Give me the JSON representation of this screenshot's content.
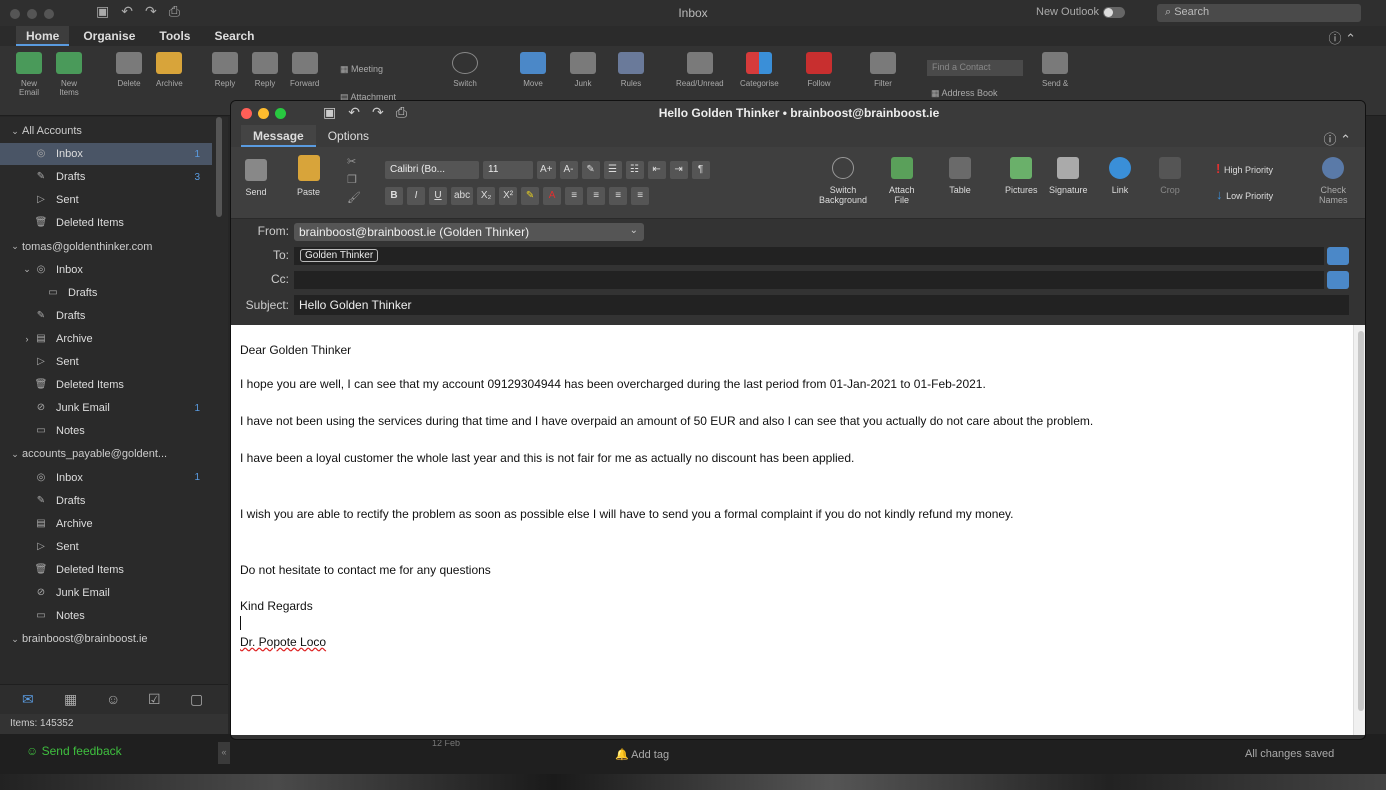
{
  "window": {
    "title": "Inbox",
    "new_outlook": "New Outlook",
    "search_placeholder": "Search"
  },
  "ribbon": {
    "tabs": [
      "Home",
      "Organise",
      "Tools",
      "Search"
    ],
    "buttons": {
      "new_email": "New\nEmail",
      "new_items": "New\nItems",
      "delete": "Delete",
      "archive": "Archive",
      "reply": "Reply",
      "reply_all": "Reply",
      "forward": "Forward",
      "meeting": "Meeting",
      "attachment": "Attachment",
      "switch": "Switch",
      "move": "Move",
      "junk": "Junk",
      "rules": "Rules",
      "read_unread": "Read/Unread",
      "categorise": "Categorise",
      "follow": "Follow",
      "filter": "Filter",
      "find_contact": "Find a Contact",
      "address_book": "Address Book",
      "send_receive": "Send &"
    }
  },
  "sidebar": {
    "items": [
      {
        "label": "All Accounts",
        "type": "account"
      },
      {
        "label": "Inbox",
        "count": "1",
        "icon": "inbox-icon",
        "selected": true
      },
      {
        "label": "Drafts",
        "count": "3",
        "icon": "drafts-icon"
      },
      {
        "label": "Sent",
        "icon": "sent-icon"
      },
      {
        "label": "Deleted Items",
        "icon": "trash-icon"
      },
      {
        "label": "tomas@goldenthinker.com",
        "type": "account"
      },
      {
        "label": "Inbox",
        "icon": "inbox-icon"
      },
      {
        "label": "Drafts",
        "icon": "folder-icon"
      },
      {
        "label": "Drafts",
        "icon": "drafts-icon"
      },
      {
        "label": "Archive",
        "icon": "archive-icon"
      },
      {
        "label": "Sent",
        "icon": "sent-icon"
      },
      {
        "label": "Deleted Items",
        "icon": "trash-icon"
      },
      {
        "label": "Junk Email",
        "count": "1",
        "icon": "junk-icon"
      },
      {
        "label": "Notes",
        "icon": "notes-icon"
      },
      {
        "label": "accounts_payable@goldent...",
        "type": "account"
      },
      {
        "label": "Inbox",
        "count": "1",
        "icon": "inbox-icon"
      },
      {
        "label": "Drafts",
        "icon": "drafts-icon"
      },
      {
        "label": "Archive",
        "icon": "archive-icon"
      },
      {
        "label": "Sent",
        "icon": "sent-icon"
      },
      {
        "label": "Deleted Items",
        "icon": "trash-icon"
      },
      {
        "label": "Junk Email",
        "icon": "junk-icon"
      },
      {
        "label": "Notes",
        "icon": "notes-icon"
      },
      {
        "label": "brainboost@brainboost.ie",
        "type": "account"
      }
    ],
    "items_count": "Items: 145352"
  },
  "status": {
    "feedback": "Send feedback",
    "date": "12 Feb",
    "add_tag": "Add tag",
    "saved": "All changes saved"
  },
  "compose": {
    "title": "Hello Golden Thinker • brainboost@brainboost.ie",
    "tabs": [
      "Message",
      "Options"
    ],
    "buttons": {
      "send": "Send",
      "paste": "Paste",
      "font": "Calibri (Bo...",
      "size": "11",
      "switch_background": "Switch\nBackground",
      "attach_file": "Attach\nFile",
      "table": "Table",
      "pictures": "Pictures",
      "signature": "Signature",
      "link": "Link",
      "crop": "Crop",
      "high_priority": "High Priority",
      "low_priority": "Low Priority",
      "check_names": "Check\nNames"
    },
    "fields": {
      "from_label": "From:",
      "from_value": "brainboost@brainboost.ie (Golden Thinker)",
      "to_label": "To:",
      "to_value": "Golden Thinker",
      "cc_label": "Cc:",
      "subject_label": "Subject:",
      "subject_value": "Hello Golden Thinker"
    },
    "body": [
      "Dear Golden Thinker",
      "I hope you are well, I can see that my account 09129304944 has been overcharged during the last period from 01-Jan-2021  to 01-Feb-2021.",
      "I have not been using the services during that time and I have overpaid an amount of 50 EUR and also I can see that you actually do not care about the problem.",
      "I have been a loyal customer the whole last year and this is not fair for me as actually no discount has been applied.",
      "I wish you are able to rectify the problem as soon as possible else I will have to send you a formal complaint if you do not kindly refund my money.",
      "Do not hesitate to contact me for any questions",
      "Kind Regards",
      "Dr. Popote Loco"
    ]
  },
  "colors": {
    "accent": "#5a9be0",
    "feedback_green": "#3fbf3f",
    "high_priority": "#e03030",
    "low_priority": "#3a8fd8"
  }
}
